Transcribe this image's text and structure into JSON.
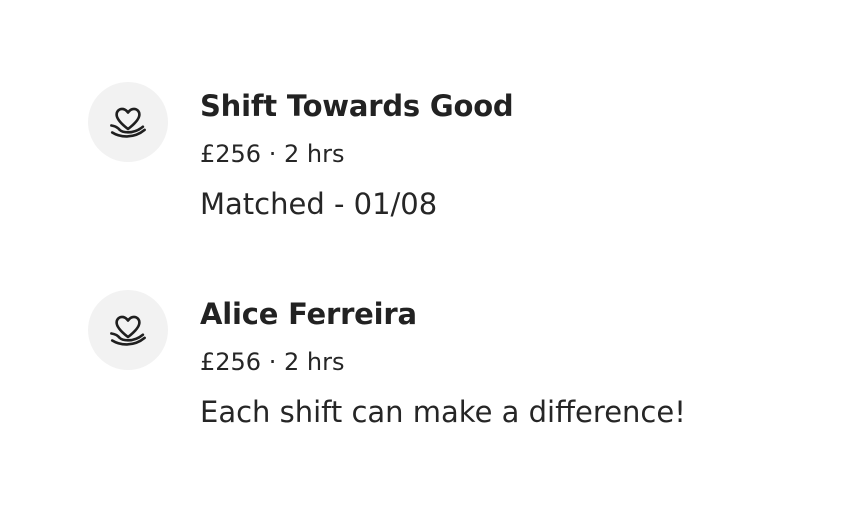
{
  "feed": {
    "items": [
      {
        "icon": "heart-in-hand-icon",
        "title": "Shift Towards Good",
        "meta": "£256 · 2 hrs",
        "status": "Matched - 01/08"
      },
      {
        "icon": "heart-in-hand-icon",
        "title": "Alice Ferreira",
        "meta": "£256 · 2 hrs",
        "status": "Each shift can make a difference!"
      }
    ]
  },
  "colors": {
    "background": "#ffffff",
    "avatar_background": "#f2f2f2",
    "text": "#222222",
    "icon_stroke": "#1f1f1f"
  }
}
